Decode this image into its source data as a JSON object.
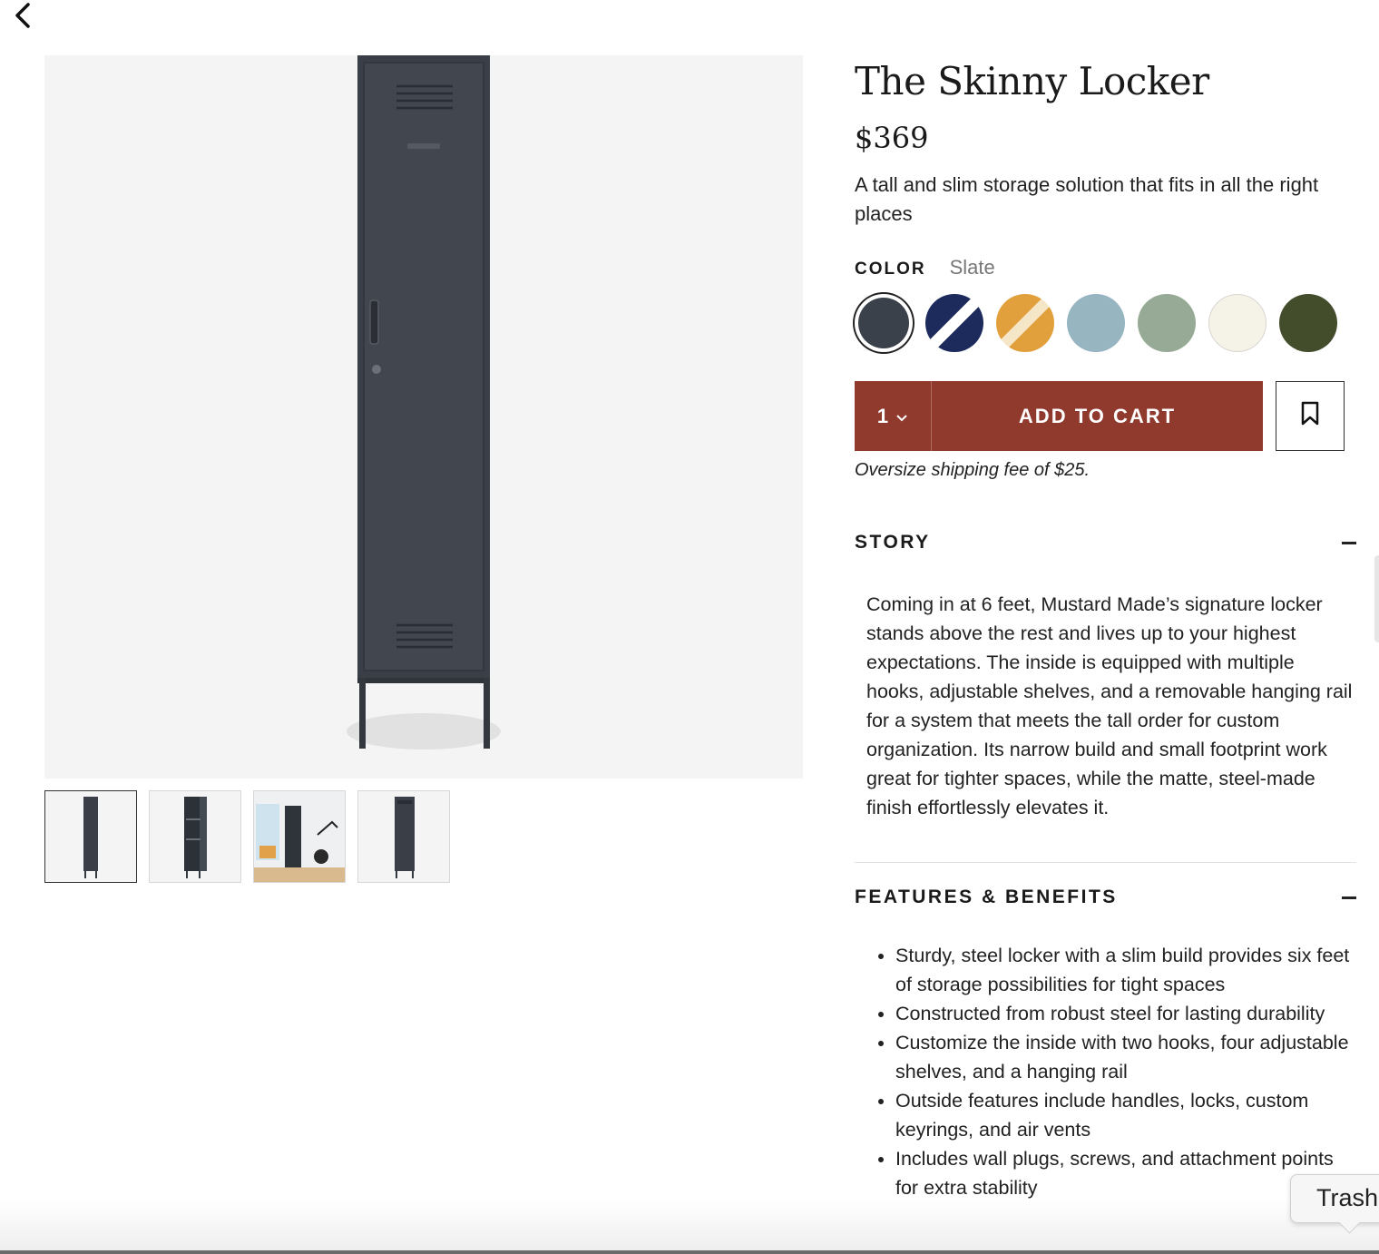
{
  "nav": {
    "back_icon": "chevron-left-icon"
  },
  "product": {
    "title": "The Skinny Locker",
    "price": "$369",
    "tagline": "A tall and slim storage solution that fits in all the right places",
    "color_label": "COLOR",
    "selected_color": "Slate",
    "swatches": [
      {
        "color": "#3a414a",
        "striped": false,
        "stripe": ""
      },
      {
        "color": "#1c2a5c",
        "striped": true,
        "stripe": "#ffffff"
      },
      {
        "color": "#e1a03c",
        "striped": true,
        "stripe": "#f5e6c8"
      },
      {
        "color": "#97b4c1",
        "striped": false,
        "stripe": ""
      },
      {
        "color": "#97aa96",
        "striped": false,
        "stripe": ""
      },
      {
        "color": "#f5f3e8",
        "striped": false,
        "stripe": ""
      },
      {
        "color": "#434d2c",
        "striped": false,
        "stripe": ""
      }
    ],
    "quantity": "1",
    "add_to_cart": "ADD TO CART",
    "shipping_note": "Oversize shipping fee of $25."
  },
  "story": {
    "title": "STORY",
    "body": "Coming in at 6 feet, Mustard Made’s signature locker stands above the rest and lives up to your highest expectations. The inside is equipped with multiple hooks, adjustable shelves, and a removable hanging rail for a system that meets the tall order for custom organization. Its narrow build and small footprint work great for tighter spaces, while the matte, steel-made finish effortlessly elevates it."
  },
  "features": {
    "title": "FEATURES & BENEFITS",
    "items": [
      "Sturdy, steel locker with a slim build provides six feet of storage possibilities for tight spaces",
      "Constructed from robust steel for lasting durability",
      "Customize the inside with two hooks, four adjustable shelves, and a hanging rail",
      "Outside features include handles, locks, custom keyrings, and air vents",
      "Includes wall plugs, screws, and attachment points for extra stability"
    ]
  },
  "tooltip": {
    "label": "Trash"
  },
  "colors": {
    "accent": "#8f3a2d",
    "locker": "#3a3f47"
  }
}
